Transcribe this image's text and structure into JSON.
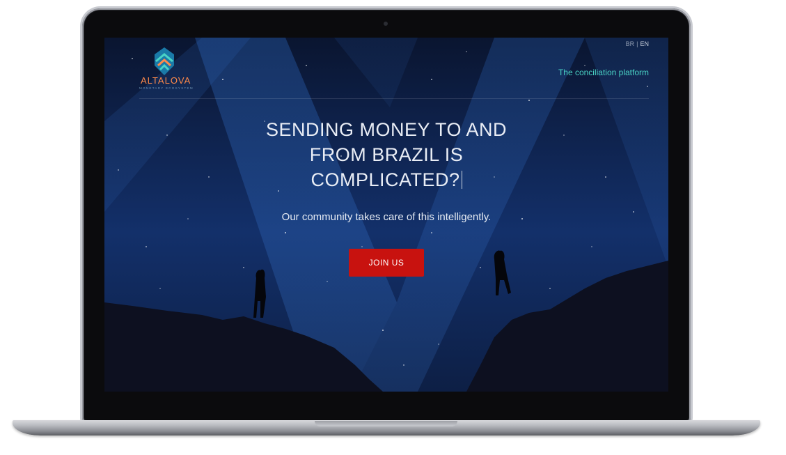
{
  "header": {
    "logo_text": "ALTALOVA",
    "logo_subtext": "MONETARY ECOSYSTEM",
    "lang_br": "BR",
    "lang_separator": "|",
    "lang_en": "EN",
    "tagline": "The conciliation platform"
  },
  "hero": {
    "title_line1": "SENDING MONEY TO AND",
    "title_line2": "FROM BRAZIL IS",
    "title_line3": "COMPLICATED?",
    "subtitle": "Our community takes care of this intelligently.",
    "cta_label": "JOIN US"
  },
  "colors": {
    "accent_teal": "#4ad3c6",
    "accent_orange": "#ff8a4a",
    "cta_red": "#c8120f",
    "sky": "#0c1830"
  },
  "icons": [
    "altalova-logo-icon",
    "webcam-icon"
  ]
}
